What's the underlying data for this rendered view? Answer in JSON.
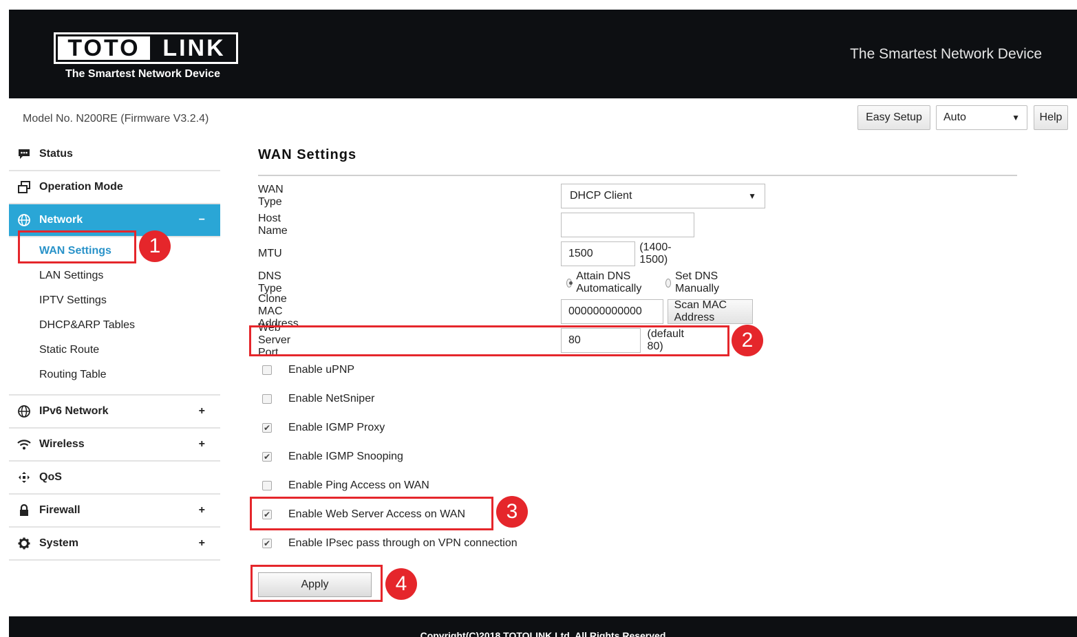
{
  "header": {
    "logo_left": "TOTO",
    "logo_right": "LINK",
    "logo_tagline": "The Smartest Network Device",
    "slogan": "The Smartest Network Device"
  },
  "model_bar": {
    "model": "Model No. N200RE (Firmware V3.2.4)",
    "easy_setup": "Easy Setup",
    "language": "Auto",
    "help": "Help"
  },
  "sidebar": {
    "status": "Status",
    "operation_mode": "Operation Mode",
    "network": "Network",
    "network_sign": "−",
    "network_sub": [
      "WAN Settings",
      "LAN Settings",
      "IPTV Settings",
      "DHCP&ARP Tables",
      "Static Route",
      "Routing Table"
    ],
    "ipv6": "IPv6 Network",
    "wireless": "Wireless",
    "qos": "QoS",
    "firewall": "Firewall",
    "system": "System",
    "plus": "+"
  },
  "main": {
    "title": "WAN Settings",
    "wan_type_label": "WAN Type",
    "wan_type_value": "DHCP Client",
    "host_name_label": "Host Name",
    "host_name_value": "",
    "mtu_label": "MTU",
    "mtu_value": "1500",
    "mtu_hint": "(1400-1500)",
    "dns_type_label": "DNS Type",
    "dns_auto": "Attain DNS Automatically",
    "dns_manual": "Set DNS Manually",
    "clone_mac_label": "Clone MAC Address",
    "clone_mac_value": "000000000000",
    "scan_mac": "Scan MAC Address",
    "web_port_label": "Web Server Port",
    "web_port_value": "80",
    "web_port_hint": "(default 80)",
    "checkboxes": [
      {
        "label": "Enable uPNP",
        "checked": false
      },
      {
        "label": "Enable NetSniper",
        "checked": false
      },
      {
        "label": "Enable IGMP Proxy",
        "checked": true
      },
      {
        "label": "Enable IGMP Snooping",
        "checked": true
      },
      {
        "label": "Enable Ping Access on WAN",
        "checked": false
      },
      {
        "label": "Enable Web Server Access on WAN",
        "checked": true
      },
      {
        "label": "Enable IPsec pass through on VPN connection",
        "checked": true
      }
    ],
    "apply": "Apply"
  },
  "annotations": [
    "1",
    "2",
    "3",
    "4"
  ],
  "footer": "Copyright(C)2018 TOTOLINK Ltd. All Rights Reserved",
  "colors": {
    "accent": "#2aa6d6",
    "annotation": "#e5262b",
    "header_bg": "#0d0f12"
  }
}
